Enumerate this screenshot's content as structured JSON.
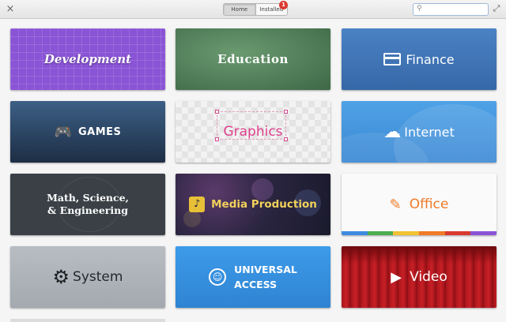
{
  "header": {
    "close_symbol": "×",
    "maximize_symbol": "⤢",
    "tabs": [
      {
        "label": "Home",
        "active": true
      },
      {
        "label": "Installed",
        "active": false
      }
    ],
    "updates_badge": "1",
    "search": {
      "value": "",
      "placeholder": "",
      "icon": "search-icon"
    }
  },
  "categories": [
    {
      "label": "Development",
      "icon": ""
    },
    {
      "label": "Education",
      "icon": ""
    },
    {
      "label": "Finance",
      "icon": "card-icon"
    },
    {
      "label": "GAMES",
      "icon": "gamepad-icon",
      "icon_glyph": "🎮"
    },
    {
      "label": "Graphics",
      "icon": ""
    },
    {
      "label": "Internet",
      "icon": "cloud-icon",
      "icon_glyph": "☁"
    },
    {
      "label_lines": [
        "Math, Science,",
        "& Engineering"
      ],
      "icon": ""
    },
    {
      "label": "Media Production",
      "icon": "media-icon",
      "icon_glyph": "♪"
    },
    {
      "label": "Office",
      "icon": "pencil-icon",
      "icon_glyph": "✎"
    },
    {
      "label": "System",
      "icon": "gear-icon",
      "icon_glyph": "⚙"
    },
    {
      "label_lines": [
        "UNIVERSAL",
        "ACCESS"
      ],
      "icon": "accessibility-icon",
      "icon_glyph": "☺"
    },
    {
      "label": "Video",
      "icon": "play-icon",
      "icon_glyph": "▶"
    }
  ],
  "colors": {
    "office_stripe": [
      "#3d8be0",
      "#4caf50",
      "#f1c232",
      "#f07a28",
      "#d93a30",
      "#8a54d6"
    ]
  }
}
